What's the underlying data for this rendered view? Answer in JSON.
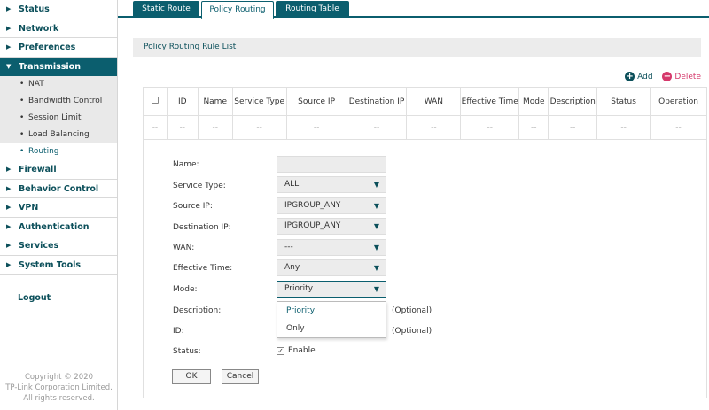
{
  "sidebar": {
    "items": [
      {
        "label": "Status"
      },
      {
        "label": "Network"
      },
      {
        "label": "Preferences"
      },
      {
        "label": "Transmission"
      },
      {
        "label": "Firewall"
      },
      {
        "label": "Behavior Control"
      },
      {
        "label": "VPN"
      },
      {
        "label": "Authentication"
      },
      {
        "label": "Services"
      },
      {
        "label": "System Tools"
      }
    ],
    "transmission_sub": [
      {
        "label": "NAT"
      },
      {
        "label": "Bandwidth Control"
      },
      {
        "label": "Session Limit"
      },
      {
        "label": "Load Balancing"
      },
      {
        "label": "Routing"
      }
    ],
    "logout": "Logout",
    "copyright": [
      "Copyright © 2020",
      "TP-Link Corporation Limited.",
      "All rights reserved."
    ]
  },
  "tabs": [
    {
      "label": "Static Route"
    },
    {
      "label": "Policy Routing"
    },
    {
      "label": "Routing Table"
    }
  ],
  "section_title": "Policy Routing Rule List",
  "actions": {
    "add": "Add",
    "delete": "Delete"
  },
  "table": {
    "headers": [
      "ID",
      "Name",
      "Service Type",
      "Source IP",
      "Destination IP",
      "WAN",
      "Effective Time",
      "Mode",
      "Description",
      "Status",
      "Operation"
    ],
    "empty_row": [
      "--",
      "--",
      "--",
      "--",
      "--",
      "--",
      "--",
      "--",
      "--",
      "--",
      "--",
      "--"
    ]
  },
  "form": {
    "name_label": "Name:",
    "name_value": "",
    "service_type_label": "Service Type:",
    "service_type_value": "ALL",
    "source_ip_label": "Source IP:",
    "source_ip_value": "IPGROUP_ANY",
    "dest_ip_label": "Destination IP:",
    "dest_ip_value": "IPGROUP_ANY",
    "wan_label": "WAN:",
    "wan_value": "---",
    "effective_time_label": "Effective Time:",
    "effective_time_value": "Any",
    "mode_label": "Mode:",
    "mode_value": "Priority",
    "mode_options": [
      "Priority",
      "Only"
    ],
    "description_label": "Description:",
    "description_optional": "(Optional)",
    "id_label": "ID:",
    "id_optional": "(Optional)",
    "status_label": "Status:",
    "status_enable": "Enable",
    "ok": "OK",
    "cancel": "Cancel"
  },
  "colors": {
    "accent": "#0b5e6e",
    "delete": "#d5386b"
  }
}
